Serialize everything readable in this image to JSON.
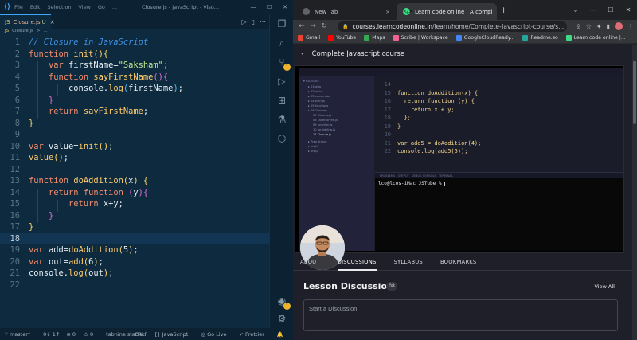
{
  "vscode": {
    "title_menu": [
      "File",
      "Edit",
      "Selection",
      "View",
      "Go",
      "..."
    ],
    "window_title": "Closure.js - JavaScript - Visu...",
    "tab": {
      "badge": "JS",
      "name": "Closure.js",
      "modified": "U"
    },
    "breadcrumb": {
      "badge": "JS",
      "file": "Closure.js",
      "sep": ">",
      "ellipsis": "..."
    },
    "code_lines": [
      {
        "n": "1",
        "tokens": [
          [
            "cm",
            "// Closure in JavaScript"
          ]
        ]
      },
      {
        "n": "2",
        "tokens": [
          [
            "kw",
            "function "
          ],
          [
            "fn",
            "init"
          ],
          [
            "br1",
            "(){"
          ]
        ]
      },
      {
        "n": "3",
        "tokens": [
          [
            "id",
            "    "
          ],
          [
            "kw",
            "var "
          ],
          [
            "id",
            "firstName="
          ],
          [
            "str",
            "\"Saksham\""
          ],
          [
            "id",
            ";"
          ]
        ]
      },
      {
        "n": "4",
        "tokens": [
          [
            "id",
            "    "
          ],
          [
            "kw",
            "function "
          ],
          [
            "fn",
            "sayFirstName"
          ],
          [
            "br2",
            "(){"
          ]
        ]
      },
      {
        "n": "5",
        "tokens": [
          [
            "id",
            "        console."
          ],
          [
            "fn",
            "log"
          ],
          [
            "br3",
            "("
          ],
          [
            "id",
            "firstName"
          ],
          [
            "br3",
            ")"
          ],
          [
            "id",
            ";"
          ]
        ]
      },
      {
        "n": "6",
        "tokens": [
          [
            "id",
            "    "
          ],
          [
            "br2",
            "}"
          ]
        ]
      },
      {
        "n": "7",
        "tokens": [
          [
            "id",
            "    "
          ],
          [
            "kw",
            "return "
          ],
          [
            "fn",
            "sayFirstName"
          ],
          [
            "id",
            ";"
          ]
        ]
      },
      {
        "n": "8",
        "tokens": [
          [
            "br1",
            "}"
          ]
        ]
      },
      {
        "n": "9",
        "tokens": []
      },
      {
        "n": "10",
        "tokens": [
          [
            "kw",
            "var "
          ],
          [
            "id",
            "value="
          ],
          [
            "fn",
            "init"
          ],
          [
            "br1",
            "()"
          ],
          [
            "id",
            ";"
          ]
        ]
      },
      {
        "n": "11",
        "tokens": [
          [
            "fn",
            "value"
          ],
          [
            "br1",
            "()"
          ],
          [
            "id",
            ";"
          ]
        ]
      },
      {
        "n": "12",
        "tokens": []
      },
      {
        "n": "13",
        "tokens": [
          [
            "kw",
            "function "
          ],
          [
            "fn",
            "doAddition"
          ],
          [
            "br1",
            "("
          ],
          [
            "id",
            "x"
          ],
          [
            "br1",
            ") {"
          ]
        ]
      },
      {
        "n": "14",
        "tokens": [
          [
            "id",
            "    "
          ],
          [
            "kw",
            "return function "
          ],
          [
            "br2",
            "("
          ],
          [
            "id",
            "y"
          ],
          [
            "br2",
            "){"
          ]
        ]
      },
      {
        "n": "15",
        "tokens": [
          [
            "id",
            "        "
          ],
          [
            "kw",
            "return "
          ],
          [
            "id",
            "x+y;"
          ]
        ]
      },
      {
        "n": "16",
        "tokens": [
          [
            "id",
            "    "
          ],
          [
            "br2",
            "}"
          ]
        ]
      },
      {
        "n": "17",
        "tokens": [
          [
            "br1",
            "}"
          ]
        ]
      },
      {
        "n": "18",
        "tokens": [],
        "current": true
      },
      {
        "n": "19",
        "tokens": [
          [
            "kw",
            "var "
          ],
          [
            "id",
            "add="
          ],
          [
            "fn",
            "doAddition"
          ],
          [
            "br1",
            "("
          ],
          [
            "id",
            "5"
          ],
          [
            "br1",
            ")"
          ],
          [
            "id",
            ";"
          ]
        ]
      },
      {
        "n": "20",
        "tokens": [
          [
            "kw",
            "var "
          ],
          [
            "id",
            "out="
          ],
          [
            "fn",
            "add"
          ],
          [
            "br1",
            "("
          ],
          [
            "id",
            "6"
          ],
          [
            "br1",
            ")"
          ],
          [
            "id",
            ";"
          ]
        ]
      },
      {
        "n": "21",
        "tokens": [
          [
            "id",
            "console."
          ],
          [
            "fn",
            "log"
          ],
          [
            "br1",
            "("
          ],
          [
            "id",
            "out"
          ],
          [
            "br1",
            ")"
          ],
          [
            "id",
            ";"
          ]
        ]
      },
      {
        "n": "22",
        "tokens": []
      }
    ],
    "status": {
      "branch": "master*",
      "sync": "0↓ 1↑",
      "errors": "0",
      "warnings": "0",
      "tabnine": "tabnine starter",
      "eol": "CRLF",
      "language": "JavaScript",
      "golive": "Go Live",
      "prettier": "Prettier"
    },
    "activity_badges": {
      "source_control": "1",
      "accounts": "1"
    }
  },
  "chrome": {
    "tabs": [
      {
        "title": "New Tab",
        "active": false
      },
      {
        "title": "Learn code online | A compl",
        "active": true
      }
    ],
    "url": {
      "host": "courses.learncodeonline.in",
      "path": "/learn/home/Complete-Javascript-course/s..."
    },
    "bookmarks": [
      {
        "label": "Gmail",
        "color": "#ea4335"
      },
      {
        "label": "YouTube",
        "color": "#ff0000"
      },
      {
        "label": "Maps",
        "color": "#34a853"
      },
      {
        "label": "Scribe | Workspace",
        "color": "#f06292"
      },
      {
        "label": "GoogleCloudReady...",
        "color": "#4285f4"
      },
      {
        "label": "Readme.so",
        "color": "#26a69a"
      },
      {
        "label": "Learn code online |...",
        "color": "#3ddc84"
      }
    ],
    "course_title": "Complete Javascript course",
    "video": {
      "code": [
        {
          "n": "14",
          "text": ""
        },
        {
          "n": "15",
          "text": "function doAddition(x) {"
        },
        {
          "n": "16",
          "text": "  return function (y) {"
        },
        {
          "n": "17",
          "text": "    return x + y;"
        },
        {
          "n": "18",
          "text": "  };"
        },
        {
          "n": "19",
          "text": "}"
        },
        {
          "n": "20",
          "text": ""
        },
        {
          "n": "21",
          "text": "var add5 = doAddition(4);"
        },
        {
          "n": "22",
          "text": "console.log(add5(5));"
        }
      ],
      "terminal": "lco@lcos-iMac JSTube % "
    },
    "course_tabs": [
      "ABOUT",
      "DISCUSSIONS",
      "SYLLABUS",
      "BOOKMARKS"
    ],
    "active_course_tab": "DISCUSSIONS",
    "discussion": {
      "title": "Lesson Discussion",
      "count": "08",
      "view_all": "View All",
      "placeholder": "Start a Discussion"
    }
  }
}
